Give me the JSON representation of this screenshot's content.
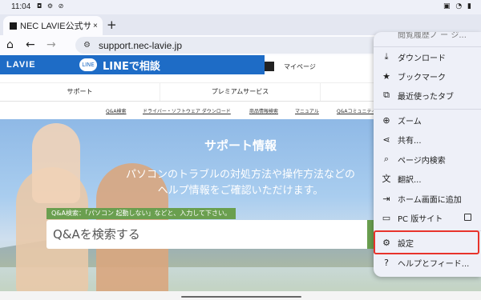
{
  "status": {
    "time": "11:04",
    "left_icons": "◘ ⚙ ⊘",
    "right_icons": "▣ ◔ ▮"
  },
  "tab": {
    "title": "NEC LAVIE公式サイ",
    "close": "×"
  },
  "new_tab": "+",
  "toolbar": {
    "home": "⌂",
    "back": "←",
    "forward": "→",
    "url": "support.nec-lavie.jp"
  },
  "site": {
    "logo": "LAVIE",
    "line_bubble": "LINE",
    "line_text": "LINEで相談",
    "mypage": "マイページ",
    "nav": [
      "サポート",
      "プレミアムサービス",
      ""
    ],
    "subnav": [
      "Q&A検索",
      "ドライバー・ソフトウェア ダウンロード",
      "商品情報検索",
      "マニュアル",
      "Q&Aコミュニティ"
    ],
    "hero_title": "サポート情報",
    "hero_desc_1": "パソコンのトラブルの対処方法や操作方法などの",
    "hero_desc_2": "ヘルプ情報をご確認いただけます。",
    "tip": "Q&A検索：「パソコン 起動しない」などと、入力して下さい。",
    "search_placeholder": "Q&Aを検索する"
  },
  "menu": {
    "items": [
      {
        "name": "partial",
        "icon": "",
        "label": "閲覧履歴ノ ー ジ..."
      },
      {
        "name": "downloads",
        "icon": "⤓",
        "label": "ダウンロード"
      },
      {
        "name": "bookmarks",
        "icon": "★",
        "label": "ブックマーク"
      },
      {
        "name": "recent-tabs",
        "icon": "⧉",
        "label": "最近使ったタブ"
      },
      {
        "name": "zoom",
        "icon": "⊕",
        "label": "ズーム"
      },
      {
        "name": "share",
        "icon": "⋖",
        "label": "共有..."
      },
      {
        "name": "find-in-page",
        "icon": "⌕",
        "label": "ページ内検索"
      },
      {
        "name": "translate",
        "icon": "文",
        "label": "翻訳..."
      },
      {
        "name": "add-to-home",
        "icon": "⇥",
        "label": "ホーム画面に追加"
      },
      {
        "name": "desktop-site",
        "icon": "▭",
        "label": "PC 版サイト"
      },
      {
        "name": "settings",
        "icon": "⚙",
        "label": "設定"
      },
      {
        "name": "help",
        "icon": "?",
        "label": "ヘルプとフィード..."
      }
    ]
  }
}
